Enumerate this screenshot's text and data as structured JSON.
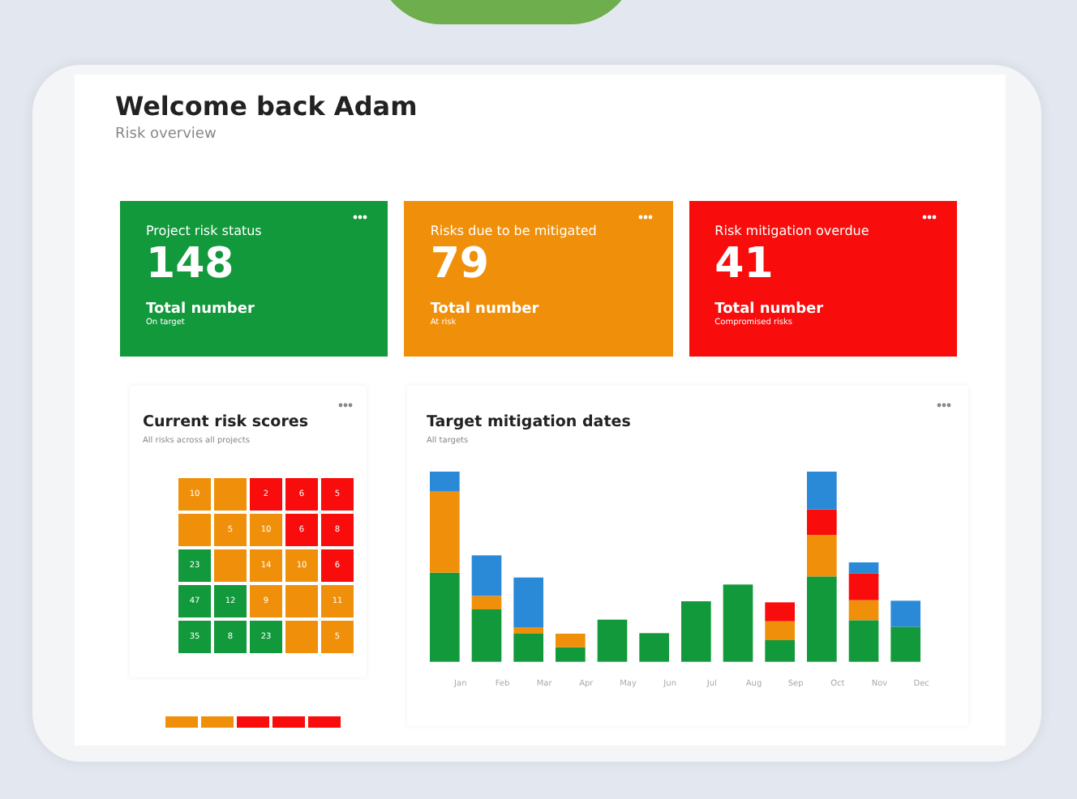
{
  "header": {
    "title": "Welcome back Adam",
    "subtitle": "Risk overview"
  },
  "stat_cards": [
    {
      "label": "Project risk status",
      "value": "148",
      "caption": "Total number",
      "note": "On target",
      "color": "#12993b"
    },
    {
      "label": "Risks due to be mitigated",
      "value": "79",
      "caption": "Total number",
      "note": "At risk",
      "color": "#f0900a"
    },
    {
      "label": "Risk mitigation overdue",
      "value": "41",
      "caption": "Total number",
      "note": "Compromised risks",
      "color": "#f80c0c"
    }
  ],
  "risk_scores": {
    "title": "Current risk scores",
    "subtitle": "All risks across all projects",
    "rows": [
      [
        {
          "value": "10",
          "color": "#f0900a"
        },
        {
          "color": "#f0900a"
        },
        {
          "value": "2",
          "color": "#f80c0c"
        },
        {
          "value": "6",
          "color": "#f80c0c"
        },
        {
          "value": "5",
          "color": "#f80c0c"
        }
      ],
      [
        {
          "color": "#f0900a"
        },
        {
          "value": "5",
          "color": "#f0900a"
        },
        {
          "value": "10",
          "color": "#f0900a"
        },
        {
          "value": "6",
          "color": "#f80c0c"
        },
        {
          "value": "8",
          "color": "#f80c0c"
        }
      ],
      [
        {
          "value": "23",
          "color": "#12993b"
        },
        {
          "color": "#f0900a"
        },
        {
          "value": "14",
          "color": "#f0900a"
        },
        {
          "value": "10",
          "color": "#f0900a"
        },
        {
          "value": "6",
          "color": "#f80c0c"
        }
      ],
      [
        {
          "value": "47",
          "color": "#12993b"
        },
        {
          "value": "12",
          "color": "#12993b"
        },
        {
          "value": "9",
          "color": "#f0900a"
        },
        {
          "color": "#f0900a"
        },
        {
          "value": "11",
          "color": "#f0900a"
        }
      ],
      [
        {
          "value": "35",
          "color": "#12993b"
        },
        {
          "value": "8",
          "color": "#12993b"
        },
        {
          "value": "23",
          "color": "#12993b"
        },
        {
          "color": "#f0900a"
        },
        {
          "value": "5",
          "color": "#f0900a"
        }
      ]
    ],
    "strip": [
      {
        "color": "#f0900a"
      },
      {
        "color": "#f0900a"
      },
      {
        "color": "#f80c0c"
      },
      {
        "color": "#f80c0c"
      },
      {
        "color": "#f80c0c"
      }
    ]
  },
  "mitigation_dates": {
    "title": "Target mitigation dates",
    "subtitle": "All targets",
    "x_labels": [
      "Jan",
      "Feb",
      "Mar",
      "Apr",
      "May",
      "Jun",
      "Jul",
      "Aug",
      "Sep",
      "Oct",
      "Nov",
      "Dec"
    ]
  }
}
